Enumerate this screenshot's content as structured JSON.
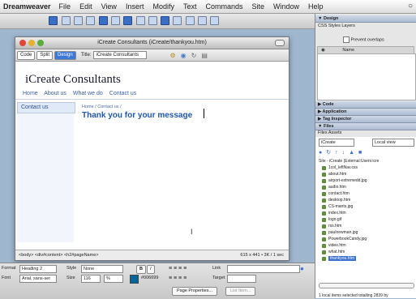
{
  "menubar": {
    "app": "Dreamweaver",
    "items": [
      "File",
      "Edit",
      "View",
      "Insert",
      "Modify",
      "Text",
      "Commands",
      "Site",
      "Window",
      "Help"
    ]
  },
  "document": {
    "window_title": "iCreate Consultants (iCreate/thankyou.htm)",
    "view_buttons": [
      "Code",
      "Split",
      "Design"
    ],
    "title_label": "Title:",
    "title_value": "iCreate Consultants"
  },
  "page": {
    "site_title": "iCreate Consultants",
    "nav": [
      "Home",
      "About us",
      "What we do",
      "Contact us"
    ],
    "sidebar_link": "Contact us",
    "breadcrumb": "Home / Contact us /",
    "message": "Thank you for your message"
  },
  "status": {
    "tags": "<body> <div#content> <h2#pageName>",
    "size": "615 x 441 • 3K / 1 sec"
  },
  "properties": {
    "format_label": "Format",
    "format_value": "Heading 2",
    "style_label": "Style",
    "style_value": "None",
    "font_label": "Font",
    "font_value": "Arial, sans-ser",
    "size_label": "Size",
    "size_value": "116",
    "size_unit": "%",
    "color_value": "#006699",
    "link_label": "Link",
    "target_label": "Target",
    "bold": "B",
    "italic": "I",
    "page_properties": "Page Properties...",
    "list_item": "List Item..."
  },
  "panels": {
    "design": "▼ Design",
    "css_tabs": "CSS Styles  Layers",
    "prevent_overlaps": "Prevent overlaps",
    "name_col": "Name",
    "code": "▶ Code",
    "application": "▶ Application",
    "tag_inspector": "▶ Tag Inspector",
    "files": "▼ Files",
    "files_tabs": "Files  Assets",
    "site_select": "iCreate",
    "view_select": "Local view",
    "root": "Site - iCreate (External:Users:icre",
    "files_list": [
      "1col_leftNav.css",
      "about.htm",
      "airport-extremedd.jpg",
      "audio.htm",
      "contact.htm",
      "desktop.htm",
      "CS-mants.jpg",
      "index.htm",
      "logo.gif",
      "rss.htm",
      "paulnewman.jpg",
      "PowerbookCandy.jpg",
      "video.htm",
      "what.htm",
      "thankyou.htm"
    ],
    "selected_file": "thankyou.htm",
    "footer": "1 local items selected totalling 2839 by"
  },
  "colors": {
    "accent_blue": "#2057b0",
    "link_blue": "#3a5fa8"
  }
}
